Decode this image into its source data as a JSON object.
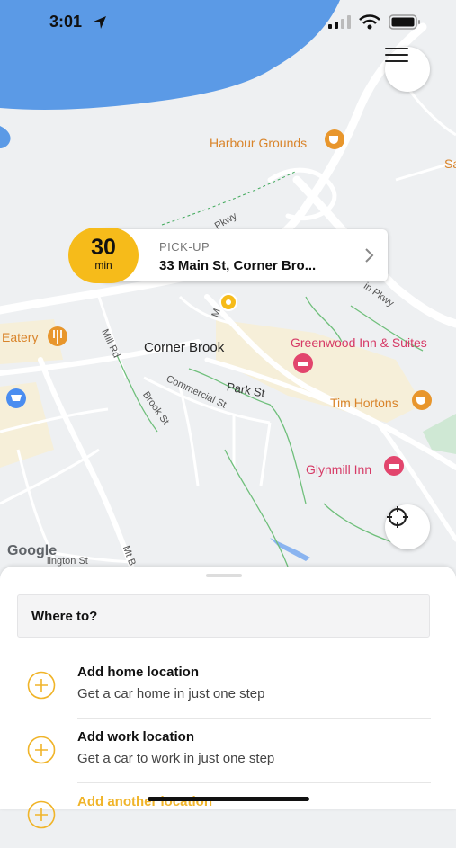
{
  "status_bar": {
    "time": "3:01"
  },
  "map": {
    "places": {
      "harbour_grounds": "Harbour Grounds",
      "eatery": "Eatery",
      "corner_brook": "Corner Brook",
      "greenwood": "Greenwood Inn & Suites",
      "tim_hortons": "Tim Hortons",
      "glynmill": "Glynmill Inn",
      "sa_partial": "Sa"
    },
    "streets": {
      "pkwy_top": "Pkwy",
      "pkwy_right": "in Pkwy",
      "main_st": "M",
      "mill_rd": "Mill Rd",
      "park_st": "Park St",
      "brook_st": "Brook St",
      "commercial_st": "Commercial St",
      "mt_b": "Mt B",
      "lington_st": "lington St"
    },
    "attribution": "Google",
    "colors": {
      "water": "#5b9ae6",
      "land": "#eef0f2",
      "accent": "#f6bb1a",
      "hotel": "#e2456d",
      "food": "#e8962c"
    }
  },
  "pickup": {
    "eta_value": "30",
    "eta_unit": "min",
    "label": "PICK-UP",
    "address": "33 Main St, Corner Bro..."
  },
  "sheet": {
    "search_label": "Where to?",
    "items": [
      {
        "title": "Add home location",
        "subtitle": "Get a car home in just one step"
      },
      {
        "title": "Add work location",
        "subtitle": "Get a car to work in just one step"
      },
      {
        "title": "Add another location",
        "subtitle": ""
      }
    ]
  },
  "icons": [
    "location-arrow-icon",
    "signal-icon",
    "wifi-icon",
    "battery-icon",
    "menu-icon",
    "recenter-icon",
    "plus-circle-icon",
    "chevron-right-icon",
    "cafe-icon",
    "restaurant-icon",
    "hotel-icon",
    "shopping-icon"
  ]
}
